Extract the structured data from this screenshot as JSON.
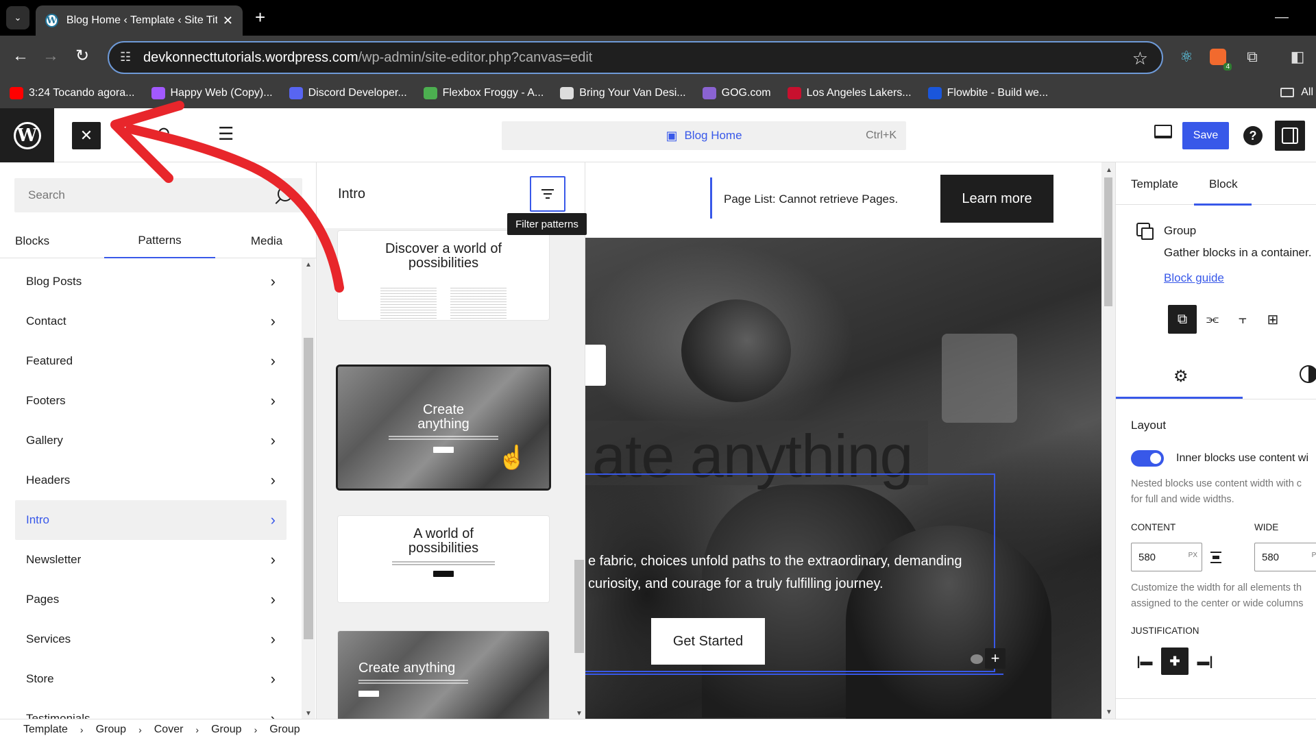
{
  "browser": {
    "tab_title": "Blog Home ‹ Template ‹ Site Titl",
    "url_host": "devkonnecttutorials.wordpress.com",
    "url_path": "/wp-admin/site-editor.php?canvas=edit",
    "extension_badge": "4",
    "bookmarks": [
      {
        "label": "3:24 Tocando agora...",
        "color": "#ff0000"
      },
      {
        "label": "Happy Web (Copy)...",
        "color": "#a259ff"
      },
      {
        "label": "Discord Developer...",
        "color": "#5865f2"
      },
      {
        "label": "Flexbox Froggy - A...",
        "color": "#4caf50"
      },
      {
        "label": "Bring Your Van Desi...",
        "color": "#dddddd"
      },
      {
        "label": "GOG.com",
        "color": "#8a63d2"
      },
      {
        "label": "Los Angeles Lakers...",
        "color": "#c8102e"
      },
      {
        "label": "Flowbite - Build we...",
        "color": "#1a56db"
      }
    ],
    "bookmarks_all": "All"
  },
  "editor_header": {
    "command_title": "Blog Home",
    "command_shortcut": "Ctrl+K",
    "save_label": "Save",
    "help_label": "?"
  },
  "inserter": {
    "search_placeholder": "Search",
    "tabs": [
      "Blocks",
      "Patterns",
      "Media"
    ],
    "active_tab": "Patterns",
    "categories": [
      "Blog Posts",
      "Contact",
      "Featured",
      "Footers",
      "Gallery",
      "Headers",
      "Intro",
      "Newsletter",
      "Pages",
      "Services",
      "Store",
      "Testimonials"
    ],
    "active_category": "Intro"
  },
  "patterns_panel": {
    "title": "Intro",
    "filter_tooltip": "Filter patterns",
    "cards": [
      {
        "heading": "Discover a world of possibilities",
        "style": "light"
      },
      {
        "heading": "Create anything",
        "style": "dark",
        "selected": true
      },
      {
        "heading": "A world of possibilities",
        "style": "light"
      },
      {
        "heading": "Create anything",
        "style": "dark"
      }
    ]
  },
  "canvas": {
    "notice": "Page List: Cannot retrieve Pages.",
    "learn_more": "Learn more",
    "hero_title": "ate anything",
    "hero_sub_line1": "e fabric, choices unfold paths to the extraordinary, demanding",
    "hero_sub_line2": "curiosity, and courage for a truly fulfilling journey.",
    "cta": "Get Started"
  },
  "sidebar": {
    "tabs": [
      "Template",
      "Block"
    ],
    "active_tab": "Block",
    "block_name": "Group",
    "block_desc": "Gather blocks in a container.",
    "block_guide": "Block guide",
    "layout_title": "Layout",
    "toggle_label": "Inner blocks use content wi",
    "toggle_on": true,
    "help_line1": "Nested blocks use content width with c",
    "help_line2": "for full and wide widths.",
    "content_label": "CONTENT",
    "wide_label": "WIDE",
    "content_value": "580",
    "wide_value": "580",
    "unit": "PX",
    "help2_line1": "Customize the width for all elements th",
    "help2_line2": "assigned to the center or wide columns",
    "justification_label": "JUSTIFICATION"
  },
  "footer": {
    "breadcrumbs": [
      "Template",
      "Group",
      "Cover",
      "Group",
      "Group"
    ]
  },
  "colors": {
    "accent": "#3858e9",
    "annotation_arrow": "#e8262b",
    "dark": "#1e1e1e"
  }
}
